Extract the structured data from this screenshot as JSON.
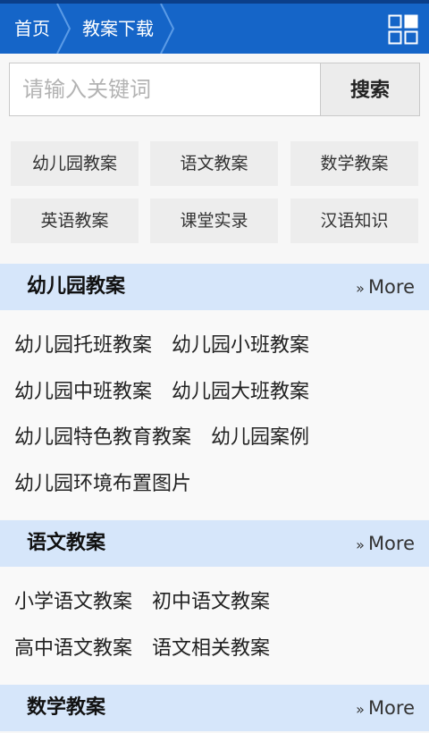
{
  "header": {
    "home_label": "首页",
    "current_label": "教案下载",
    "grid_icon": "grid-icon",
    "bg_color": "#1565c8"
  },
  "search": {
    "placeholder": "请输入关键词",
    "button_label": "搜索"
  },
  "categories": [
    "幼儿园教案",
    "语文教案",
    "数学教案",
    "英语教案",
    "课堂实录",
    "汉语知识"
  ],
  "sections": [
    {
      "title": "幼儿园教案",
      "more_prefix": "»",
      "more_label": "More",
      "rows": [
        [
          "幼儿园托班教案",
          "幼儿园小班教案"
        ],
        [
          "幼儿园中班教案",
          "幼儿园大班教案"
        ],
        [
          "幼儿园特色教育教案",
          "幼儿园案例"
        ],
        [
          "幼儿园环境布置图片"
        ]
      ]
    },
    {
      "title": "语文教案",
      "more_prefix": "»",
      "more_label": "More",
      "rows": [
        [
          "小学语文教案",
          "初中语文教案"
        ],
        [
          "高中语文教案",
          "语文相关教案"
        ]
      ]
    },
    {
      "title": "数学教案",
      "more_prefix": "»",
      "more_label": "More",
      "rows": []
    }
  ],
  "colors": {
    "section_header_bg": "#d6e6fa",
    "category_bg": "#ededed"
  }
}
